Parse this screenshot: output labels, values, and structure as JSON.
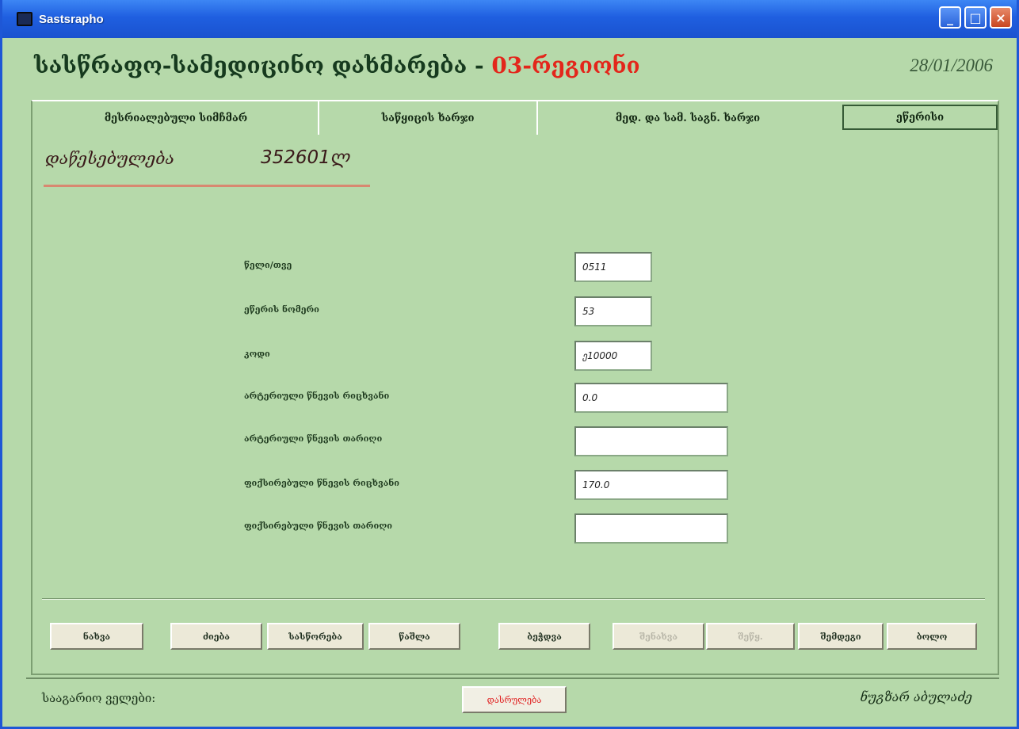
{
  "window": {
    "title": "Sastsrapho"
  },
  "header": {
    "title_main": "სასწრაფო-სამედიცინო დახმარება - ",
    "title_region": "03-რეგიონი",
    "date": "28/01/2006"
  },
  "tabs": [
    {
      "label": "მესრიალებული სიმჩმარ"
    },
    {
      "label": "საწყიცის ხარჯი"
    },
    {
      "label": "მედ. და სამ. საგნ. ხარჯი"
    },
    {
      "label": "ეწერისი"
    }
  ],
  "section": {
    "label": "დაწესებულება",
    "value": "352601ლ"
  },
  "form": {
    "fields": [
      {
        "label": "წელი/თვე",
        "value": "0511"
      },
      {
        "label": "ეწერის ნომერი",
        "value": "53"
      },
      {
        "label": "კოდი",
        "value": "ე10000"
      },
      {
        "label": "არტერიული წნევის რიცხვანი",
        "value": "0.0"
      },
      {
        "label": "არტერიული წნევის თარიღი",
        "value": ""
      },
      {
        "label": "ფიქსირებული წნევის რიცხვანი",
        "value": "170.0"
      },
      {
        "label": "ფიქსირებული წნევის თარიღი",
        "value": ""
      }
    ]
  },
  "buttons": [
    {
      "label": "ნახვა",
      "disabled": false
    },
    {
      "label": "ძიება",
      "disabled": false
    },
    {
      "label": "სასწორება",
      "disabled": false
    },
    {
      "label": "წაშლა",
      "disabled": false
    },
    {
      "label": "ბეჭდვა",
      "disabled": false
    },
    {
      "label": "შენახვა",
      "disabled": true
    },
    {
      "label": "შეწყ.",
      "disabled": true
    },
    {
      "label": "შემდეგი",
      "disabled": false
    },
    {
      "label": "ბოლო",
      "disabled": false
    }
  ],
  "statusbar": {
    "label": "სააგარიო ველები:",
    "button": "დასრულება",
    "user": "ნუგზარ აბულაძე"
  },
  "colors": {
    "background": "#b6d9aa",
    "titlebar": "#1f5fe0",
    "region_red": "#e3261b"
  }
}
